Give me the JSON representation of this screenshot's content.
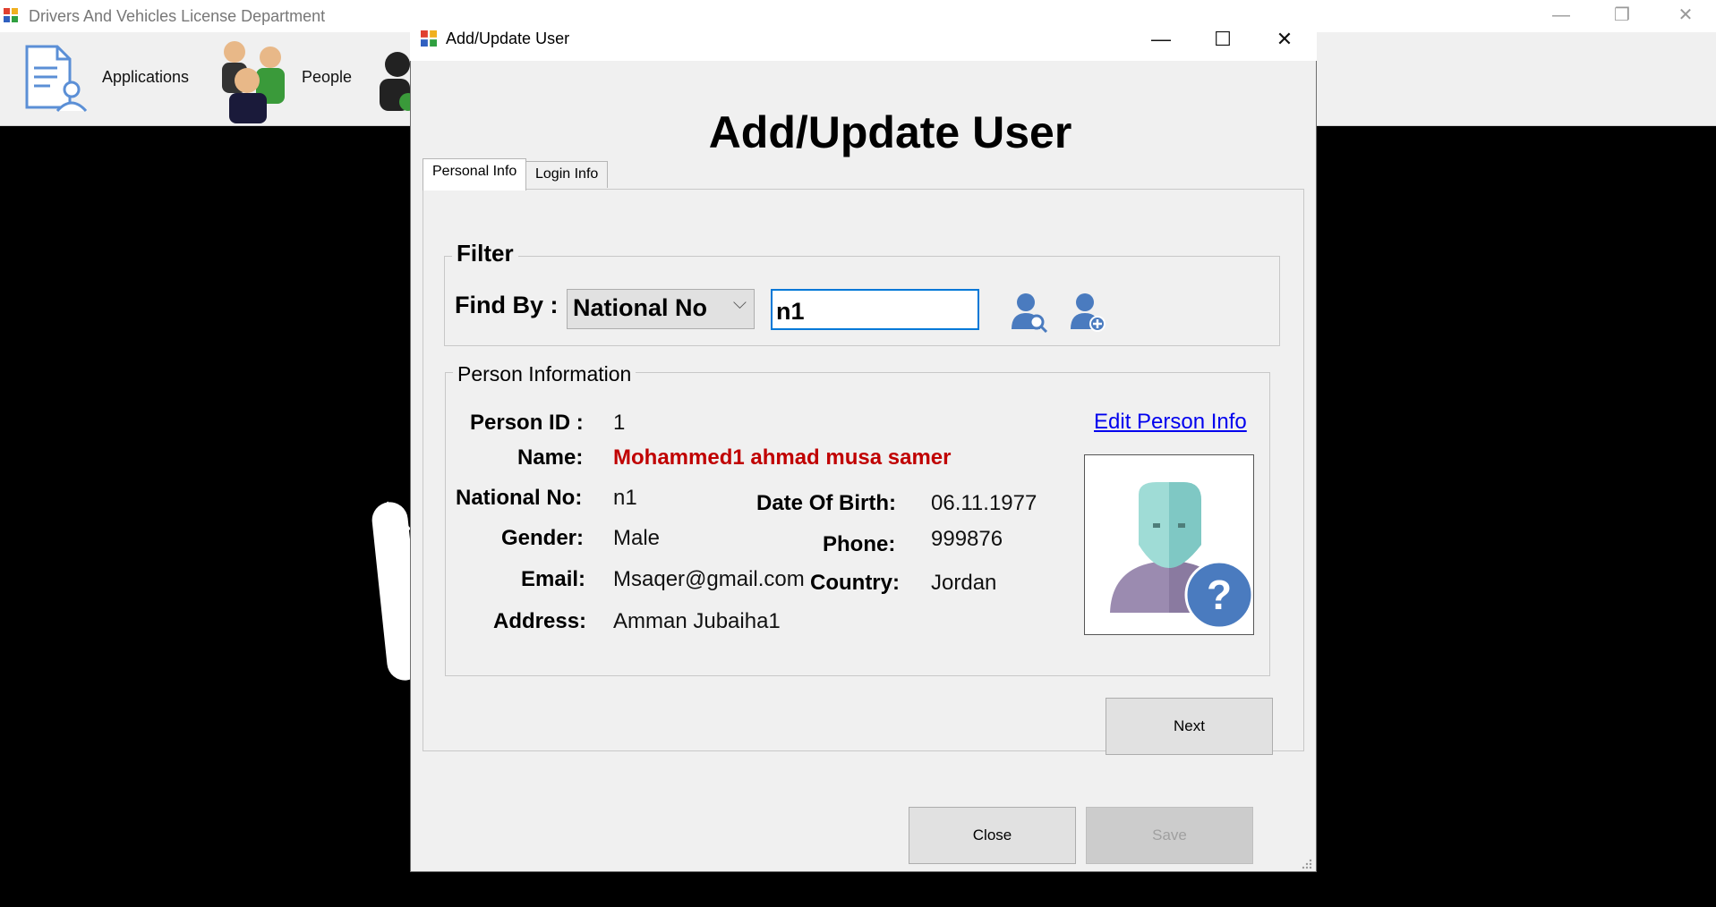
{
  "main_window": {
    "title": "Drivers And Vehicles License Department",
    "toolbar": [
      {
        "label": "Applications",
        "icon": "applications-icon"
      },
      {
        "label": "People",
        "icon": "people-icon"
      }
    ],
    "controls": {
      "minimize": "—",
      "restore": "❐",
      "close": "✕"
    }
  },
  "dialog": {
    "title": "Add/Update User",
    "heading": "Add/Update User",
    "controls": {
      "minimize": "—",
      "maximize": "☐",
      "close": "✕"
    },
    "tabs": [
      {
        "label": "Personal Info",
        "active": true
      },
      {
        "label": "Login Info",
        "active": false
      }
    ],
    "filter": {
      "group_title": "Filter",
      "find_by_label": "Find By :",
      "find_by_value": "National No",
      "search_value": "n1"
    },
    "person": {
      "group_title": "Person Information",
      "edit_link": "Edit Person Info",
      "fields": {
        "person_id": {
          "label": "Person ID :",
          "value": "1"
        },
        "name": {
          "label": "Name:",
          "value": "Mohammed1 ahmad musa samer"
        },
        "national_no": {
          "label": "National No:",
          "value": "n1"
        },
        "date_of_birth": {
          "label": "Date Of Birth:",
          "value": "06.11.1977"
        },
        "gender": {
          "label": "Gender:",
          "value": "Male"
        },
        "phone": {
          "label": "Phone:",
          "value": "999876"
        },
        "email": {
          "label": "Email:",
          "value": "Msaqer@gmail.com"
        },
        "country": {
          "label": "Country:",
          "value": "Jordan"
        },
        "address": {
          "label": "Address:",
          "value": "Amman Jubaiha1"
        }
      }
    },
    "buttons": {
      "next": "Next",
      "close": "Close",
      "save": "Save"
    }
  },
  "colors": {
    "name_value": "#c00000",
    "link": "#0000ee",
    "focus_border": "#0078d7",
    "person_icon": "#4a7bbf"
  }
}
